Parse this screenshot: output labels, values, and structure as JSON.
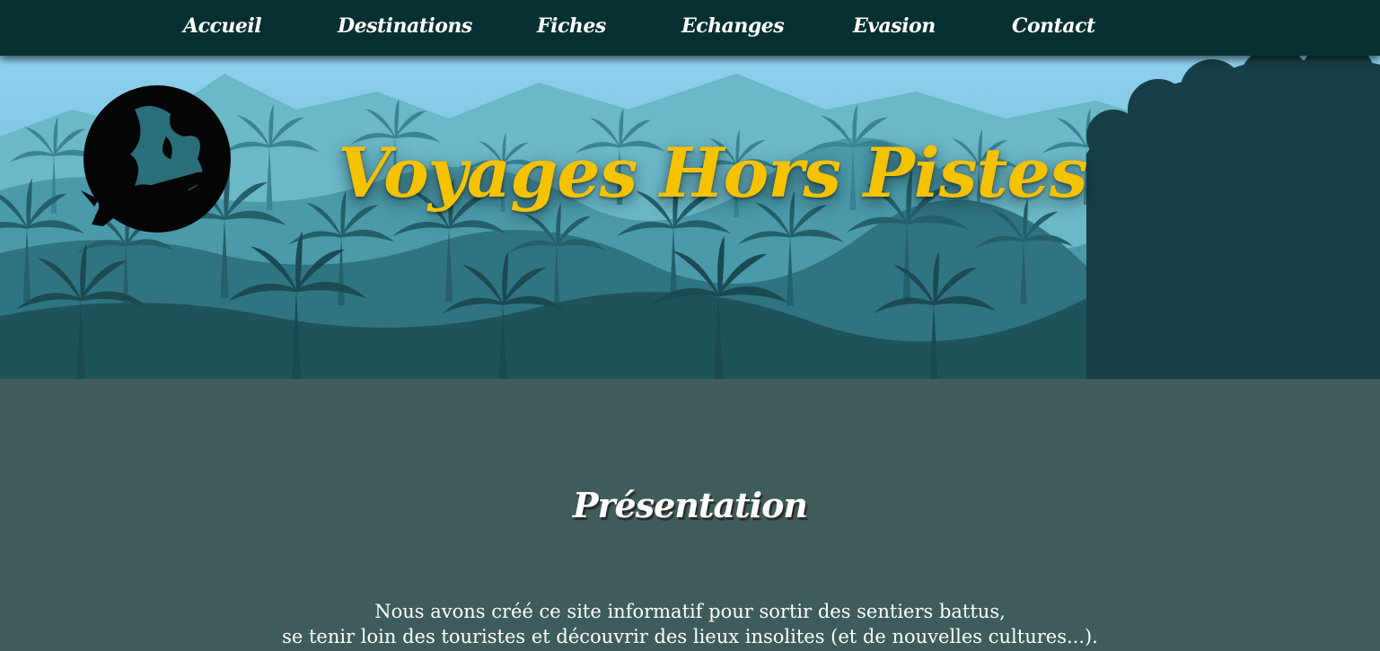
{
  "nav": {
    "items": [
      {
        "label": "Accueil"
      },
      {
        "label": "Destinations"
      },
      {
        "label": "Fiches"
      },
      {
        "label": "Echanges"
      },
      {
        "label": "Evasion"
      },
      {
        "label": "Contact"
      }
    ]
  },
  "header": {
    "title": "Voyages Hors Pistes",
    "logo_icon": "globe-airplane-icon"
  },
  "main": {
    "section_title": "Présentation",
    "intro_lines": [
      "Nous avons créé ce site informatif pour sortir des sentiers battus,",
      "se tenir loin des touristes et découvrir des lieux insolites (et de nouvelles cultures...)."
    ]
  },
  "colors": {
    "nav_bg": "#062f31",
    "title": "#f5c200",
    "content_bg": "#3d5c5a",
    "sky": "#8fd0ee"
  }
}
